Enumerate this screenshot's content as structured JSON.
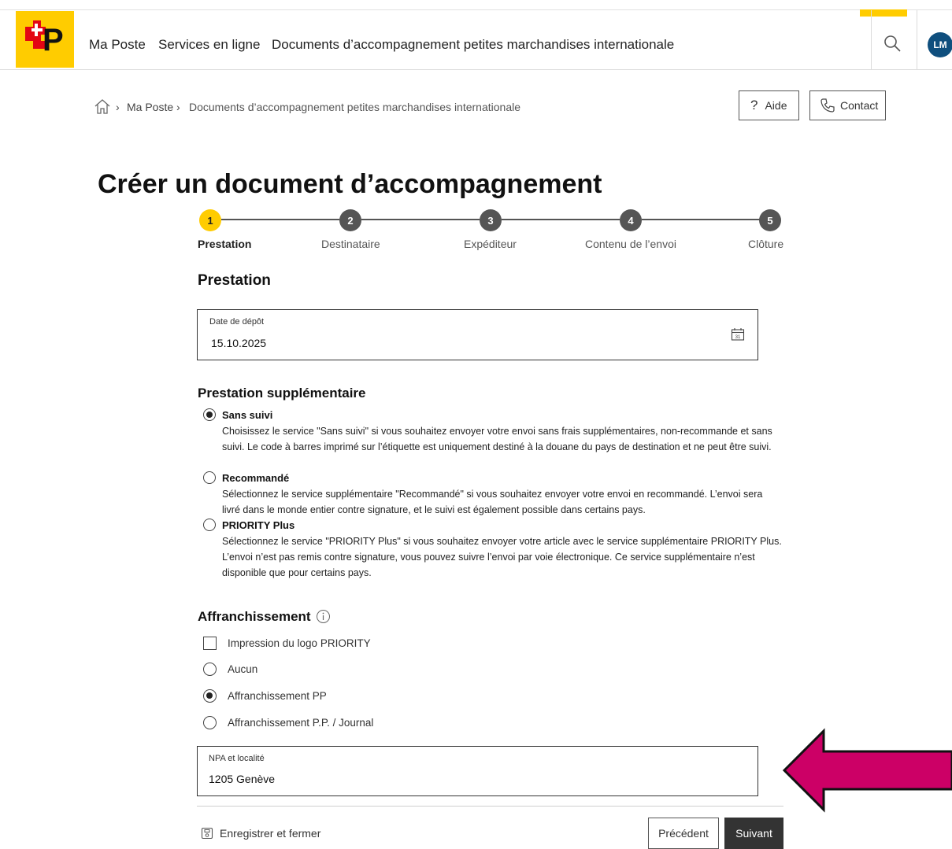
{
  "header": {
    "nav": [
      "Ma Poste",
      "Services en ligne",
      "Documents d’accompagnement petites marchandises internationale"
    ],
    "avatar_initials": "LM"
  },
  "breadcrumb": {
    "items": [
      "Ma Poste",
      "Documents d’accompagnement petites marchandises internationale"
    ]
  },
  "actions": {
    "help": "Aide",
    "contact": "Contact"
  },
  "page_title": "Créer un document d’accompagnement",
  "stepper": {
    "steps": [
      {
        "num": "1",
        "label": "Prestation"
      },
      {
        "num": "2",
        "label": "Destinataire"
      },
      {
        "num": "3",
        "label": "Expéditeur"
      },
      {
        "num": "4",
        "label": "Contenu de l’envoi"
      },
      {
        "num": "5",
        "label": "Clôture"
      }
    ],
    "active_step": 1
  },
  "prestation": {
    "heading": "Prestation",
    "date_label": "Date de dépôt",
    "date_value": "15.10.2025",
    "calendar_day": "31"
  },
  "supplementary": {
    "heading": "Prestation supplémentaire",
    "options": [
      {
        "title": "Sans suivi",
        "checked": true,
        "desc": "Choisissez le service \"Sans suivi\" si vous souhaitez envoyer votre envoi sans frais supplémentaires, non-recommande et sans suivi. Le code à barres imprimé sur l’étiquette est uniquement destiné à la douane du pays de destination et ne peut être suivi."
      },
      {
        "title": "Recommandé",
        "checked": false,
        "desc": "Sélectionnez le service supplémentaire \"Recommandé\" si vous souhaitez envoyer votre envoi en recommandé. L’envoi sera livré dans le monde entier contre signature, et le suivi est également possible dans certains pays."
      },
      {
        "title": "PRIORITY Plus",
        "checked": false,
        "desc": "Sélectionnez le service \"PRIORITY Plus\" si vous souhaitez envoyer votre article avec le service supplémentaire PRIORITY Plus. L’envoi n’est pas remis contre signature, vous pouvez suivre l’envoi par voie électronique. Ce service supplémentaire n’est disponible que pour certains pays."
      }
    ]
  },
  "franking": {
    "heading": "Affranchissement",
    "info_icon": "info-icon",
    "priority_logo_label": "Impression du logo PRIORITY",
    "priority_logo_checked": false,
    "options": [
      {
        "label": "Aucun",
        "checked": false
      },
      {
        "label": "Affranchissement PP",
        "checked": true
      },
      {
        "label": "Affranchissement P.P. / Journal",
        "checked": false
      }
    ],
    "npa_label": "NPA et localité",
    "npa_value": "1205 Genève"
  },
  "footer": {
    "save_close": "Enregistrer et fermer",
    "previous": "Précédent",
    "next": "Suivant"
  },
  "colors": {
    "brand_yellow": "#ffcc00",
    "avatar_blue": "#0f4f7e",
    "arrow_magenta": "#cc0066",
    "dark_button": "#333333"
  }
}
